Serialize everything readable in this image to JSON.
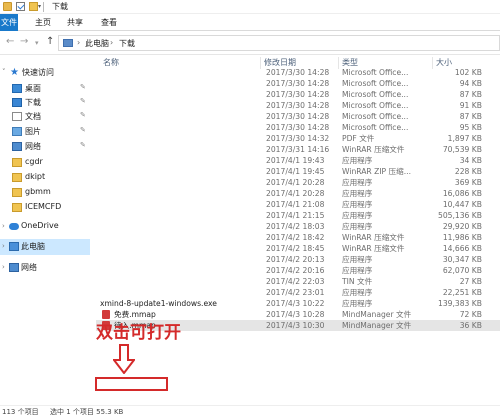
{
  "window": {
    "title": "下载"
  },
  "ribbon": {
    "tabs": [
      "文件",
      "主页",
      "共享",
      "查看"
    ]
  },
  "address": {
    "breadcrumbs": [
      "此电脑",
      "下载"
    ]
  },
  "sidebar": {
    "quick_access": "快速访问",
    "items": [
      {
        "label": "桌面",
        "pinned": true
      },
      {
        "label": "下载",
        "pinned": true
      },
      {
        "label": "文档",
        "pinned": true
      },
      {
        "label": "图片",
        "pinned": true
      },
      {
        "label": "网络",
        "pinned": true
      },
      {
        "label": "cgdr"
      },
      {
        "label": "dkipt"
      },
      {
        "label": "gbmm"
      },
      {
        "label": "ICEMCFD"
      }
    ],
    "onedrive": "OneDrive",
    "this_pc": "此电脑",
    "network": "网络"
  },
  "columns": {
    "name": "名称",
    "date": "修改日期",
    "type": "类型",
    "size": "大小"
  },
  "files": [
    {
      "name": "",
      "date": "2017/3/30 14:28",
      "type": "Microsoft Office...",
      "size": "102 KB"
    },
    {
      "name": "",
      "date": "2017/3/30 14:28",
      "type": "Microsoft Office...",
      "size": "94 KB"
    },
    {
      "name": "",
      "date": "2017/3/30 14:28",
      "type": "Microsoft Office...",
      "size": "87 KB"
    },
    {
      "name": "",
      "date": "2017/3/30 14:28",
      "type": "Microsoft Office...",
      "size": "91 KB"
    },
    {
      "name": "",
      "date": "2017/3/30 14:28",
      "type": "Microsoft Office...",
      "size": "87 KB"
    },
    {
      "name": "",
      "date": "2017/3/30 14:28",
      "type": "Microsoft Office...",
      "size": "95 KB"
    },
    {
      "name": "",
      "date": "2017/3/30 14:32",
      "type": "PDF 文件",
      "size": "1,897 KB"
    },
    {
      "name": "",
      "date": "2017/3/31 14:16",
      "type": "WinRAR 压缩文件",
      "size": "70,539 KB"
    },
    {
      "name": "",
      "date": "2017/4/1 19:43",
      "type": "应用程序",
      "size": "34 KB"
    },
    {
      "name": "",
      "date": "2017/4/1 19:45",
      "type": "WinRAR ZIP 压缩...",
      "size": "228 KB"
    },
    {
      "name": "",
      "date": "2017/4/1 20:28",
      "type": "应用程序",
      "size": "369 KB"
    },
    {
      "name": "",
      "date": "2017/4/1 20:28",
      "type": "应用程序",
      "size": "16,086 KB"
    },
    {
      "name": "",
      "date": "2017/4/1 21:08",
      "type": "应用程序",
      "size": "10,447 KB"
    },
    {
      "name": "",
      "date": "2017/4/1 21:15",
      "type": "应用程序",
      "size": "505,136 KB"
    },
    {
      "name": "",
      "date": "2017/4/2 18:03",
      "type": "应用程序",
      "size": "29,920 KB"
    },
    {
      "name": "",
      "date": "2017/4/2 18:42",
      "type": "WinRAR 压缩文件",
      "size": "11,986 KB"
    },
    {
      "name": "",
      "date": "2017/4/2 18:45",
      "type": "WinRAR 压缩文件",
      "size": "14,666 KB"
    },
    {
      "name": "",
      "date": "2017/4/2 20:13",
      "type": "应用程序",
      "size": "30,347 KB"
    },
    {
      "name": "",
      "date": "2017/4/2 20:16",
      "type": "应用程序",
      "size": "62,070 KB"
    },
    {
      "name": "",
      "date": "2017/4/2 22:03",
      "type": "TIN 文件",
      "size": "27 KB"
    },
    {
      "name": "",
      "date": "2017/4/2 23:01",
      "type": "应用程序",
      "size": "22,251 KB"
    },
    {
      "name": "xmind-8-update1-windows.exe",
      "date": "2017/4/3 10:22",
      "type": "应用程序",
      "size": "139,383 KB"
    },
    {
      "name": "免费.mmap",
      "date": "2017/4/3 10:28",
      "type": "MindManager 文件",
      "size": "72 KB",
      "icon": "mindmanager-file"
    },
    {
      "name": "待入.mmap",
      "date": "2017/4/3 10:30",
      "type": "MindManager 文件",
      "size": "36 KB",
      "icon": "mindmanager-file"
    }
  ],
  "annotation": {
    "text": "双击可打开"
  },
  "status": {
    "count": "113 个项目",
    "selected": "选中 1 个项目  55.3 KB"
  },
  "colors": {
    "accent": "#1979ca",
    "annotation": "#d42a2a",
    "selection": "#cce8ff"
  }
}
